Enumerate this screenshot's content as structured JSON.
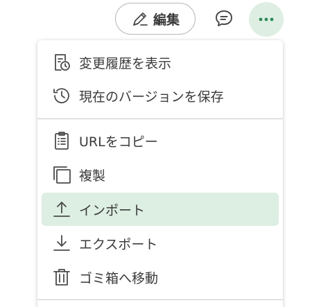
{
  "toolbar": {
    "edit_label": "編集",
    "icons": {
      "edit": "pencil-icon",
      "comment": "comment-icon",
      "more": "more-dots-icon"
    },
    "accent_bg": "#deeee3"
  },
  "menu": {
    "items": [
      {
        "label": "変更履歴を表示",
        "icon": "history-document-icon"
      },
      {
        "label": "現在のバージョンを保存",
        "icon": "history-clock-icon"
      },
      {
        "label": "URLをコピー",
        "icon": "clipboard-icon"
      },
      {
        "label": "複製",
        "icon": "duplicate-icon"
      },
      {
        "label": "インポート",
        "icon": "upload-icon",
        "selected": true
      },
      {
        "label": "エクスポート",
        "icon": "download-icon"
      },
      {
        "label": "ゴミ箱へ移動",
        "icon": "trash-icon"
      }
    ],
    "highlight_color": "#ddeee2"
  }
}
